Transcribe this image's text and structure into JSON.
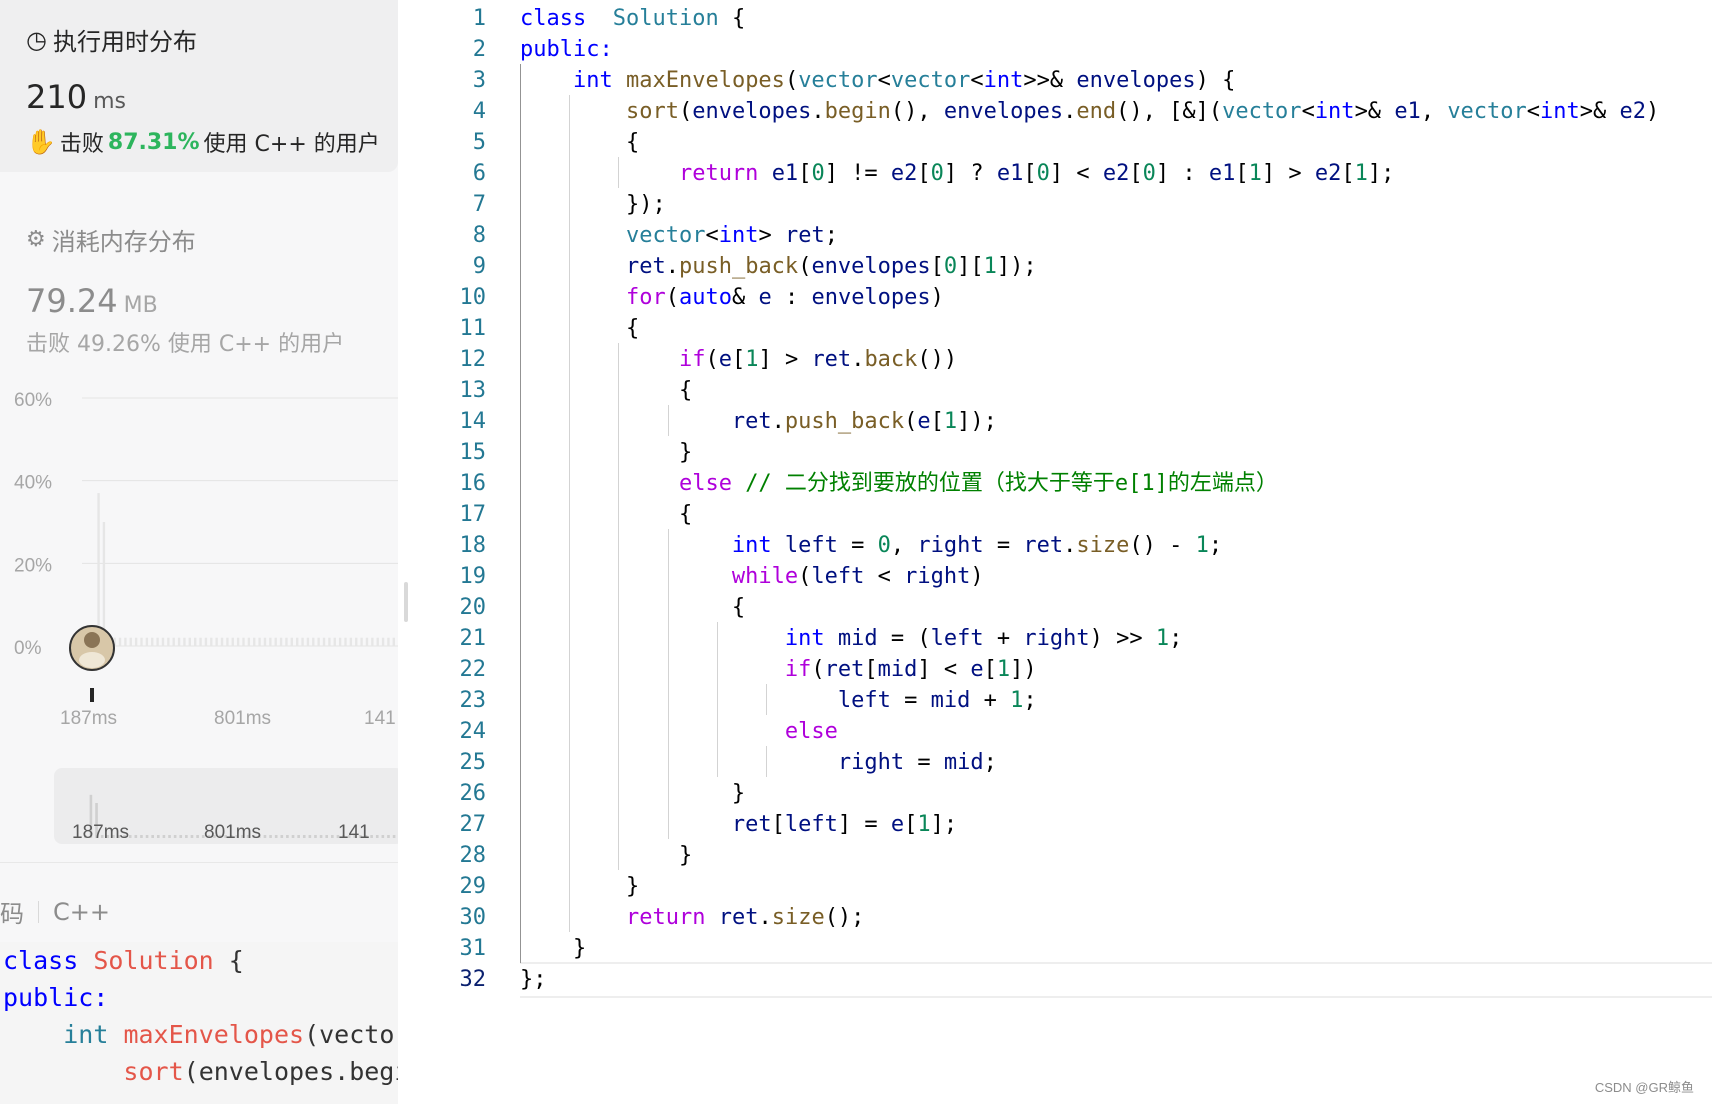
{
  "runtime": {
    "title": "执行用时分布",
    "value": "210",
    "unit": "ms",
    "beat_prefix": "击败",
    "beat_percent": "87.31%",
    "beat_suffix": "使用 C++ 的用户"
  },
  "memory": {
    "title": "消耗内存分布",
    "value": "79.24",
    "unit": "MB",
    "beat_text": "击败 49.26% 使用 C++ 的用户"
  },
  "chart_data": {
    "type": "bar",
    "y_tick_labels": [
      "60%",
      "40%",
      "20%",
      "0%"
    ],
    "x_tick_labels": [
      "187ms",
      "801ms",
      "141"
    ],
    "ylim": [
      0,
      60
    ],
    "values": [
      2,
      37,
      30,
      2,
      2,
      2,
      2,
      2,
      2,
      2,
      2,
      2,
      2,
      2,
      2,
      2,
      2,
      2,
      2,
      2,
      2,
      2,
      2,
      2,
      2,
      2,
      2,
      2,
      2,
      2,
      2,
      2,
      2,
      2,
      2,
      2,
      2,
      2,
      2,
      2,
      2,
      2,
      2,
      2,
      2,
      2,
      2,
      2,
      2,
      2,
      2,
      2,
      2,
      2,
      2,
      2,
      2
    ],
    "grid": true,
    "mini_x_tick_labels": [
      "187ms",
      "801ms",
      "141"
    ]
  },
  "code_lang_row": {
    "left_label": "码",
    "lang": "C++"
  },
  "mini_code": [
    [
      [
        "mkw",
        "class"
      ],
      [
        "mpl",
        " "
      ],
      [
        "mfn",
        "Solution"
      ],
      [
        "mpl",
        " {"
      ]
    ],
    [
      [
        "mkw",
        "public:"
      ]
    ],
    [
      [
        "mpl",
        "    "
      ],
      [
        "mty",
        "int"
      ],
      [
        "mpl",
        " "
      ],
      [
        "mfn",
        "maxEnvelopes"
      ],
      [
        "mpl",
        "(vector"
      ]
    ],
    [
      [
        "mpl",
        "        "
      ],
      [
        "mfn",
        "sort"
      ],
      [
        "mpl",
        "(envelopes.begi"
      ]
    ]
  ],
  "editor": {
    "active_line": 32,
    "lines": [
      {
        "n": "1",
        "tokens": [
          [
            "kw",
            "class"
          ],
          [
            "",
            "  "
          ],
          [
            "ty",
            "Solution"
          ],
          [
            "",
            " {"
          ]
        ]
      },
      {
        "n": "2",
        "tokens": [
          [
            "kw",
            "public:"
          ]
        ]
      },
      {
        "n": "3",
        "tokens": [
          [
            "",
            "    "
          ],
          [
            "kw",
            "int"
          ],
          [
            "",
            " "
          ],
          [
            "fn",
            "maxEnvelopes"
          ],
          [
            "",
            "("
          ],
          [
            "ty",
            "vector"
          ],
          [
            "",
            "<"
          ],
          [
            "ty",
            "vector"
          ],
          [
            "",
            "<"
          ],
          [
            "kw",
            "int"
          ],
          [
            "",
            ">>& "
          ],
          [
            "var",
            "envelopes"
          ],
          [
            "",
            ") {"
          ]
        ]
      },
      {
        "n": "4",
        "tokens": [
          [
            "",
            "        "
          ],
          [
            "fn",
            "sort"
          ],
          [
            "",
            "("
          ],
          [
            "var",
            "envelopes"
          ],
          [
            "",
            "."
          ],
          [
            "fn",
            "begin"
          ],
          [
            "",
            "(), "
          ],
          [
            "var",
            "envelopes"
          ],
          [
            "",
            "."
          ],
          [
            "fn",
            "end"
          ],
          [
            "",
            "(), [&]("
          ],
          [
            "ty",
            "vector"
          ],
          [
            "",
            "<"
          ],
          [
            "kw",
            "int"
          ],
          [
            "",
            ">& "
          ],
          [
            "var",
            "e1"
          ],
          [
            "",
            ", "
          ],
          [
            "ty",
            "vector"
          ],
          [
            "",
            "<"
          ],
          [
            "kw",
            "int"
          ],
          [
            "",
            ">& "
          ],
          [
            "var",
            "e2"
          ],
          [
            "",
            ")"
          ]
        ]
      },
      {
        "n": "5",
        "tokens": [
          [
            "",
            "        {"
          ]
        ]
      },
      {
        "n": "6",
        "tokens": [
          [
            "",
            "            "
          ],
          [
            "ctl",
            "return"
          ],
          [
            "",
            " "
          ],
          [
            "var",
            "e1"
          ],
          [
            "",
            "["
          ],
          [
            "num",
            "0"
          ],
          [
            "",
            "] != "
          ],
          [
            "var",
            "e2"
          ],
          [
            "",
            "["
          ],
          [
            "num",
            "0"
          ],
          [
            "",
            "] ? "
          ],
          [
            "var",
            "e1"
          ],
          [
            "",
            "["
          ],
          [
            "num",
            "0"
          ],
          [
            "",
            "] < "
          ],
          [
            "var",
            "e2"
          ],
          [
            "",
            "["
          ],
          [
            "num",
            "0"
          ],
          [
            "",
            "] : "
          ],
          [
            "var",
            "e1"
          ],
          [
            "",
            "["
          ],
          [
            "num",
            "1"
          ],
          [
            "",
            "] > "
          ],
          [
            "var",
            "e2"
          ],
          [
            "",
            "["
          ],
          [
            "num",
            "1"
          ],
          [
            "",
            "];"
          ]
        ]
      },
      {
        "n": "7",
        "tokens": [
          [
            "",
            "        });"
          ]
        ]
      },
      {
        "n": "8",
        "tokens": [
          [
            "",
            "        "
          ],
          [
            "ty",
            "vector"
          ],
          [
            "",
            "<"
          ],
          [
            "kw",
            "int"
          ],
          [
            "",
            "> "
          ],
          [
            "var",
            "ret"
          ],
          [
            "",
            ";"
          ]
        ]
      },
      {
        "n": "9",
        "tokens": [
          [
            "",
            "        "
          ],
          [
            "var",
            "ret"
          ],
          [
            "",
            "."
          ],
          [
            "fn",
            "push_back"
          ],
          [
            "",
            "("
          ],
          [
            "var",
            "envelopes"
          ],
          [
            "",
            "["
          ],
          [
            "num",
            "0"
          ],
          [
            "",
            "]["
          ],
          [
            "num",
            "1"
          ],
          [
            "",
            "]);"
          ]
        ]
      },
      {
        "n": "10",
        "tokens": [
          [
            "",
            "        "
          ],
          [
            "ctl",
            "for"
          ],
          [
            "",
            "("
          ],
          [
            "kw",
            "auto"
          ],
          [
            "",
            "& "
          ],
          [
            "var",
            "e"
          ],
          [
            "",
            " : "
          ],
          [
            "var",
            "envelopes"
          ],
          [
            "",
            ")"
          ]
        ]
      },
      {
        "n": "11",
        "tokens": [
          [
            "",
            "        {"
          ]
        ]
      },
      {
        "n": "12",
        "tokens": [
          [
            "",
            "            "
          ],
          [
            "ctl",
            "if"
          ],
          [
            "",
            "("
          ],
          [
            "var",
            "e"
          ],
          [
            "",
            "["
          ],
          [
            "num",
            "1"
          ],
          [
            "",
            "] > "
          ],
          [
            "var",
            "ret"
          ],
          [
            "",
            "."
          ],
          [
            "fn",
            "back"
          ],
          [
            "",
            "())"
          ]
        ]
      },
      {
        "n": "13",
        "tokens": [
          [
            "",
            "            {"
          ]
        ]
      },
      {
        "n": "14",
        "tokens": [
          [
            "",
            "                "
          ],
          [
            "var",
            "ret"
          ],
          [
            "",
            "."
          ],
          [
            "fn",
            "push_back"
          ],
          [
            "",
            "("
          ],
          [
            "var",
            "e"
          ],
          [
            "",
            "["
          ],
          [
            "num",
            "1"
          ],
          [
            "",
            "]);"
          ]
        ]
      },
      {
        "n": "15",
        "tokens": [
          [
            "",
            "            }"
          ]
        ]
      },
      {
        "n": "16",
        "tokens": [
          [
            "",
            "            "
          ],
          [
            "ctl",
            "else"
          ],
          [
            "",
            " "
          ],
          [
            "cm",
            "// 二分找到要放的位置（找大于等于e[1]的左端点）"
          ]
        ]
      },
      {
        "n": "17",
        "tokens": [
          [
            "",
            "            {"
          ]
        ]
      },
      {
        "n": "18",
        "tokens": [
          [
            "",
            "                "
          ],
          [
            "kw",
            "int"
          ],
          [
            "",
            " "
          ],
          [
            "var",
            "left"
          ],
          [
            "",
            " = "
          ],
          [
            "num",
            "0"
          ],
          [
            "",
            ", "
          ],
          [
            "var",
            "right"
          ],
          [
            "",
            " = "
          ],
          [
            "var",
            "ret"
          ],
          [
            "",
            "."
          ],
          [
            "fn",
            "size"
          ],
          [
            "",
            "() - "
          ],
          [
            "num",
            "1"
          ],
          [
            "",
            ";"
          ]
        ]
      },
      {
        "n": "19",
        "tokens": [
          [
            "",
            "                "
          ],
          [
            "ctl",
            "while"
          ],
          [
            "",
            "("
          ],
          [
            "var",
            "left"
          ],
          [
            "",
            " < "
          ],
          [
            "var",
            "right"
          ],
          [
            "",
            ")"
          ]
        ]
      },
      {
        "n": "20",
        "tokens": [
          [
            "",
            "                {"
          ]
        ]
      },
      {
        "n": "21",
        "tokens": [
          [
            "",
            "                    "
          ],
          [
            "kw",
            "int"
          ],
          [
            "",
            " "
          ],
          [
            "var",
            "mid"
          ],
          [
            "",
            " = ("
          ],
          [
            "var",
            "left"
          ],
          [
            "",
            " + "
          ],
          [
            "var",
            "right"
          ],
          [
            "",
            ") >> "
          ],
          [
            "num",
            "1"
          ],
          [
            "",
            ";"
          ]
        ]
      },
      {
        "n": "22",
        "tokens": [
          [
            "",
            "                    "
          ],
          [
            "ctl",
            "if"
          ],
          [
            "",
            "("
          ],
          [
            "var",
            "ret"
          ],
          [
            "",
            "["
          ],
          [
            "var",
            "mid"
          ],
          [
            "",
            "] < "
          ],
          [
            "var",
            "e"
          ],
          [
            "",
            "["
          ],
          [
            "num",
            "1"
          ],
          [
            "",
            "])"
          ]
        ]
      },
      {
        "n": "23",
        "tokens": [
          [
            "",
            "                        "
          ],
          [
            "var",
            "left"
          ],
          [
            "",
            " = "
          ],
          [
            "var",
            "mid"
          ],
          [
            "",
            " + "
          ],
          [
            "num",
            "1"
          ],
          [
            "",
            ";"
          ]
        ]
      },
      {
        "n": "24",
        "tokens": [
          [
            "",
            "                    "
          ],
          [
            "ctl",
            "else"
          ]
        ]
      },
      {
        "n": "25",
        "tokens": [
          [
            "",
            "                        "
          ],
          [
            "var",
            "right"
          ],
          [
            "",
            " = "
          ],
          [
            "var",
            "mid"
          ],
          [
            "",
            ";"
          ]
        ]
      },
      {
        "n": "26",
        "tokens": [
          [
            "",
            "                }"
          ]
        ]
      },
      {
        "n": "27",
        "tokens": [
          [
            "",
            "                "
          ],
          [
            "var",
            "ret"
          ],
          [
            "",
            "["
          ],
          [
            "var",
            "left"
          ],
          [
            "",
            "] = "
          ],
          [
            "var",
            "e"
          ],
          [
            "",
            "["
          ],
          [
            "num",
            "1"
          ],
          [
            "",
            "];"
          ]
        ]
      },
      {
        "n": "28",
        "tokens": [
          [
            "",
            "            }"
          ]
        ]
      },
      {
        "n": "29",
        "tokens": [
          [
            "",
            "        }"
          ]
        ]
      },
      {
        "n": "30",
        "tokens": [
          [
            "",
            "        "
          ],
          [
            "ctl",
            "return"
          ],
          [
            "",
            " "
          ],
          [
            "var",
            "ret"
          ],
          [
            "",
            "."
          ],
          [
            "fn",
            "size"
          ],
          [
            "",
            "();"
          ]
        ]
      },
      {
        "n": "31",
        "tokens": [
          [
            "",
            "    }"
          ]
        ]
      },
      {
        "n": "32",
        "tokens": [
          [
            "",
            "};"
          ]
        ]
      }
    ]
  },
  "watermark": "CSDN @GR鲸鱼",
  "icons": {
    "runtime": "clock-icon",
    "memory": "chip-icon",
    "beat": "clap-hands-icon",
    "avatar": "avatar"
  }
}
